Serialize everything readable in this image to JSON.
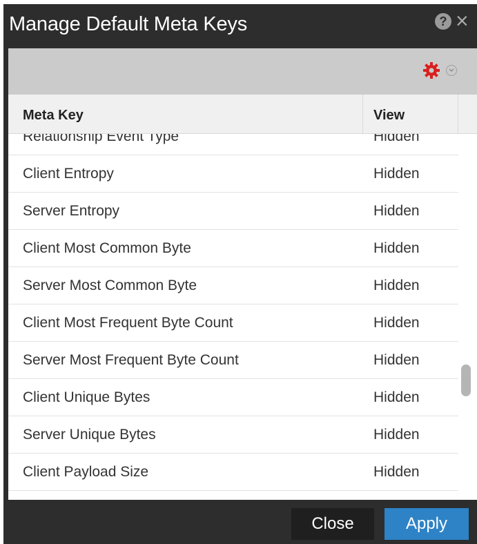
{
  "dialog": {
    "title": "Manage Default Meta Keys",
    "help_icon": "?",
    "close_icon": "×"
  },
  "toolbar": {
    "gear_icon": "gear-icon",
    "gear_color": "#d9201e",
    "dropdown_icon": "chevron-down-icon"
  },
  "table": {
    "headers": {
      "key": "Meta Key",
      "view": "View"
    },
    "rows": [
      {
        "key": "Relationship Event Type",
        "view": "Hidden"
      },
      {
        "key": "Client Entropy",
        "view": "Hidden"
      },
      {
        "key": "Server Entropy",
        "view": "Hidden"
      },
      {
        "key": "Client Most Common Byte",
        "view": "Hidden"
      },
      {
        "key": "Server Most Common Byte",
        "view": "Hidden"
      },
      {
        "key": "Client Most Frequent Byte Count",
        "view": "Hidden"
      },
      {
        "key": "Server Most Frequent Byte Count",
        "view": "Hidden"
      },
      {
        "key": "Client Unique Bytes",
        "view": "Hidden"
      },
      {
        "key": "Server Unique Bytes",
        "view": "Hidden"
      },
      {
        "key": "Client Payload Size",
        "view": "Hidden"
      }
    ]
  },
  "footer": {
    "close_label": "Close",
    "apply_label": "Apply",
    "apply_color": "#2d83c6"
  }
}
